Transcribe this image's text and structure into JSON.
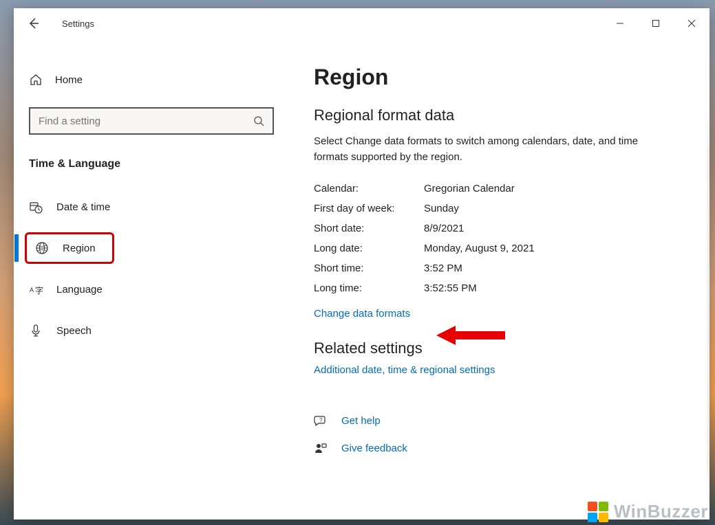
{
  "titlebar": {
    "title": "Settings"
  },
  "sidebar": {
    "home_label": "Home",
    "search_placeholder": "Find a setting",
    "category": "Time & Language",
    "items": [
      {
        "label": "Date & time",
        "icon": "calendar-clock-icon"
      },
      {
        "label": "Region",
        "icon": "globe-icon",
        "selected": true
      },
      {
        "label": "Language",
        "icon": "language-a-icon"
      },
      {
        "label": "Speech",
        "icon": "microphone-icon"
      }
    ]
  },
  "main": {
    "page_title": "Region",
    "section_title": "Regional format data",
    "section_desc": "Select Change data formats to switch among calendars, date, and time formats supported by the region.",
    "rows": [
      {
        "key": "Calendar:",
        "value": "Gregorian Calendar"
      },
      {
        "key": "First day of week:",
        "value": "Sunday"
      },
      {
        "key": "Short date:",
        "value": "8/9/2021"
      },
      {
        "key": "Long date:",
        "value": "Monday, August 9, 2021"
      },
      {
        "key": "Short time:",
        "value": "3:52 PM"
      },
      {
        "key": "Long time:",
        "value": "3:52:55 PM"
      }
    ],
    "change_link": "Change data formats",
    "related_title": "Related settings",
    "related_link": "Additional date, time & regional settings",
    "help_link": "Get help",
    "feedback_link": "Give feedback"
  },
  "watermark": "WinBuzzer"
}
